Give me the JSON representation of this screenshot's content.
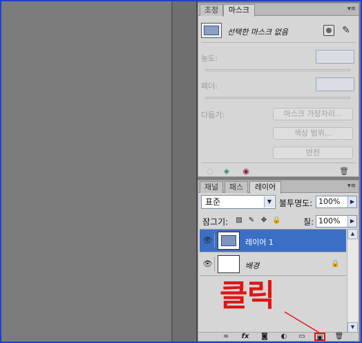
{
  "masks_panel": {
    "tabs": [
      "조정",
      "마스크"
    ],
    "active_tab": "마스크",
    "status_text": "선택한 마스크 없음",
    "density_label": "농도:",
    "feather_label": "페더:",
    "refine_label": "다듬기:",
    "buttons": [
      "마스크 가장자리...",
      "색상 범위...",
      "반전"
    ],
    "icons": [
      "menu-icon",
      "pixel-mask-icon",
      "vector-mask-icon",
      "load-selection-icon",
      "apply-mask-icon",
      "visibility-toggle-icon",
      "delete-mask-icon"
    ]
  },
  "layers_panel": {
    "tabs": [
      "채널",
      "패스",
      "레이어"
    ],
    "active_tab": "레이어",
    "blend_mode": "표준",
    "opacity_label": "불투명도:",
    "opacity_value": "100%",
    "lock_label": "잠그기:",
    "fill_label": "칠:",
    "fill_value": "100%",
    "layers": [
      {
        "name": "레이어 1",
        "selected": true,
        "visible": true,
        "locked": false
      },
      {
        "name": "배경",
        "selected": false,
        "visible": true,
        "locked": true
      }
    ],
    "footer_icons": [
      "link-icon",
      "fx-icon",
      "add-mask-icon",
      "adjustment-icon",
      "group-folder-icon",
      "new-layer-icon",
      "trash-icon"
    ]
  },
  "annotation": {
    "text": "클릭",
    "color": "#e01515"
  },
  "colors": {
    "selected_row": "#3b6fc5",
    "panel_bg": "#d6d6d6",
    "highlight": "#e21010"
  }
}
